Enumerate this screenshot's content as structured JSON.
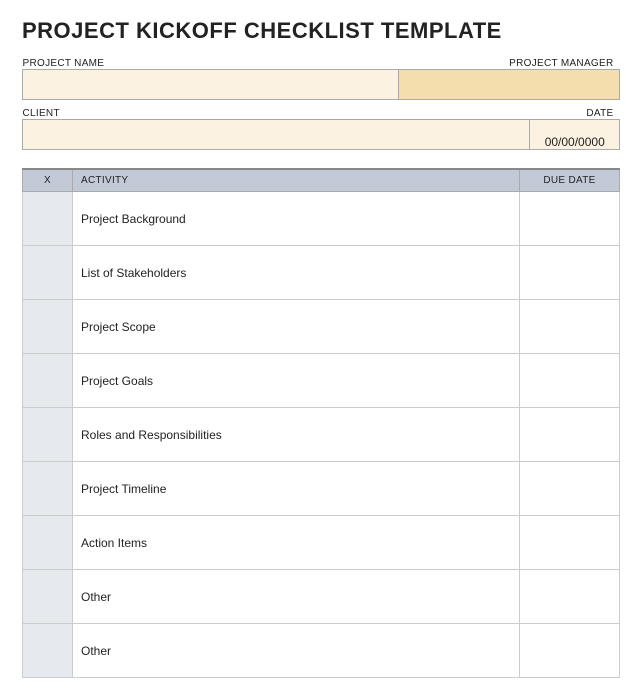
{
  "title": "PROJECT KICKOFF CHECKLIST TEMPLATE",
  "meta": {
    "project_name_label": "PROJECT NAME",
    "project_manager_label": "PROJECT MANAGER",
    "client_label": "CLIENT",
    "date_label": "DATE",
    "project_name_value": "",
    "project_manager_value": "",
    "client_value": "",
    "date_value": "00/00/0000"
  },
  "columns": {
    "x": "X",
    "activity": "ACTIVITY",
    "due": "DUE DATE"
  },
  "rows": [
    {
      "x": "",
      "activity": "Project Background",
      "due": ""
    },
    {
      "x": "",
      "activity": "List of Stakeholders",
      "due": ""
    },
    {
      "x": "",
      "activity": "Project Scope",
      "due": ""
    },
    {
      "x": "",
      "activity": "Project Goals",
      "due": ""
    },
    {
      "x": "",
      "activity": "Roles and Responsibilities",
      "due": ""
    },
    {
      "x": "",
      "activity": "Project Timeline",
      "due": ""
    },
    {
      "x": "",
      "activity": "Action Items",
      "due": ""
    },
    {
      "x": "",
      "activity": "Other",
      "due": ""
    },
    {
      "x": "",
      "activity": "Other",
      "due": ""
    }
  ]
}
